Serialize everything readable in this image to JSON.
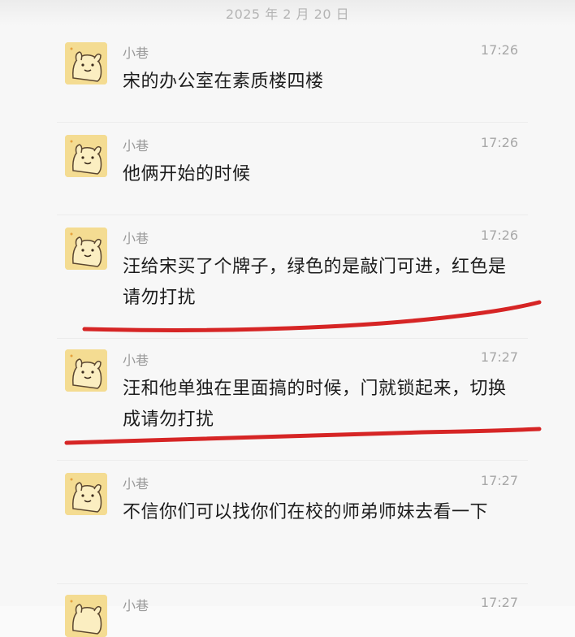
{
  "chat": {
    "date_divider": "2025 年 2 月 20 日",
    "messages": [
      {
        "sender": "小巷",
        "time": "17:26",
        "text": "宋的办公室在素质楼四楼"
      },
      {
        "sender": "小巷",
        "time": "17:26",
        "text": "他俩开始的时候"
      },
      {
        "sender": "小巷",
        "time": "17:26",
        "text": "汪给宋买了个牌子，绿色的是敲门可进，红色是请勿打扰"
      },
      {
        "sender": "小巷",
        "time": "17:27",
        "text": "汪和他单独在里面搞的时候，门就锁起来，切换成请勿打扰"
      },
      {
        "sender": "小巷",
        "time": "17:27",
        "text": "不信你们可以找你们在校的师弟师妹去看一下"
      },
      {
        "sender": "小巷",
        "time": "17:27",
        "text": ""
      }
    ]
  },
  "annotation_color": "#d62525",
  "avatar_color": "#f3d98a"
}
